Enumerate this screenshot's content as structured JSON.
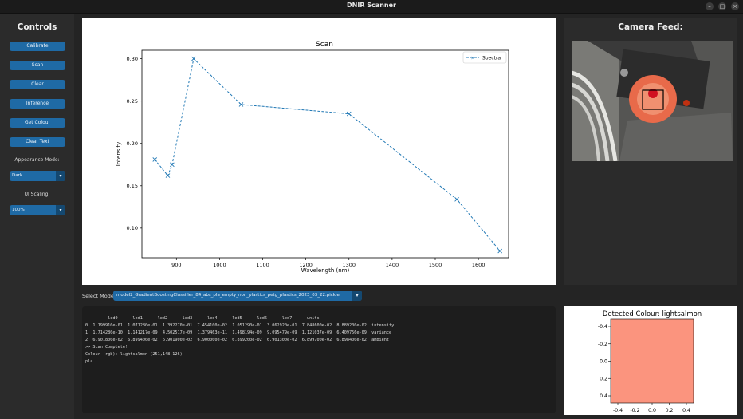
{
  "window": {
    "title": "DNIR Scanner",
    "buttons": [
      "–",
      "□",
      "×"
    ]
  },
  "sidebar": {
    "title": "Controls",
    "buttons": [
      "Calibrate",
      "Scan",
      "Clear",
      "Inference",
      "Get Colour",
      "Clear Text"
    ],
    "appearance_label": "Appearance Mode:",
    "appearance_value": "Dark",
    "scaling_label": "UI Scaling:",
    "scaling_value": "100%"
  },
  "chart_data": {
    "type": "line",
    "title": "Scan",
    "xlabel": "Wavelength (nm)",
    "ylabel": "Intensity",
    "xlim": [
      820,
      1670
    ],
    "ylim": [
      0.065,
      0.31
    ],
    "xticks": [
      900,
      1000,
      1100,
      1200,
      1300,
      1400,
      1500,
      1600
    ],
    "yticks": [
      0.1,
      0.15,
      0.2,
      0.25,
      0.3
    ],
    "ytick_labels": [
      "0.10",
      "0.15",
      "0.20",
      "0.25",
      "0.30"
    ],
    "grid": false,
    "legend_position": "top-right",
    "series": [
      {
        "name": "Spectra",
        "color": "#1f77b4",
        "x": [
          850,
          880,
          890,
          940,
          1050,
          1300,
          1550,
          1650
        ],
        "y": [
          0.181,
          0.162,
          0.175,
          0.3,
          0.246,
          0.235,
          0.134,
          0.073
        ]
      }
    ]
  },
  "model": {
    "label": "Select Model:",
    "value": "model2_GradientBoostingClassifier_84_abs_pla_empty_non_plastics_petg_plastics_2023_03_22.pickle"
  },
  "output_lines": [
    "         led0      led1      led2      led3      led4      led5      led6      led7      units",
    "0  1.199910e-01  1.071280e-01  1.392270e-01  7.454100e-02  1.051290e-01  3.062920e-01  7.848600e-02  8.889200e-02  intensity",
    "1  1.714280e-10  1.141217e-09  4.502517e-09  1.379463e-11  1.498194e-09  9.095479e-09  1.121037e-09  6.409756e-09  variance",
    "2  6.901800e-02  6.899400e-02  6.901900e-02  6.900000e-02  6.899200e-02  6.901300e-02  6.899700e-02  6.898400e-02  ambient",
    ">> Scan Complete!",
    "Colour (rgb): lightsalmon (251,148,126)",
    "pla"
  ],
  "camera": {
    "title": "Camera Feed:"
  },
  "colour_plot": {
    "title": "Detected Colour: lightsalmon",
    "color": "#fb947e",
    "yticks": [
      "-0.4",
      "-0.2",
      "0.0",
      "0.2",
      "0.4"
    ],
    "xticks": [
      "-0.4",
      "-0.2",
      "0.0",
      "0.2",
      "0.4"
    ]
  }
}
